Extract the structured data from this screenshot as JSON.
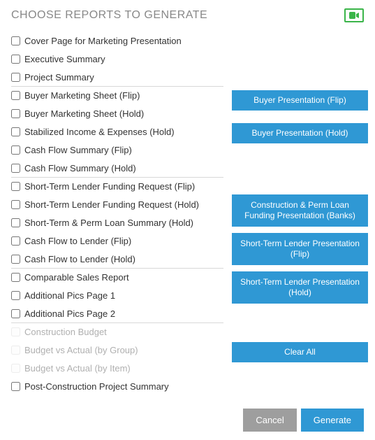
{
  "header": {
    "title": "CHOOSE REPORTS TO GENERATE"
  },
  "rows": [
    {
      "label": "Cover Page for Marketing Presentation",
      "enabled": true,
      "divider": false
    },
    {
      "label": "Executive Summary",
      "enabled": true,
      "divider": false
    },
    {
      "label": "Project Summary",
      "enabled": true,
      "divider": true
    },
    {
      "label": "Buyer Marketing Sheet (Flip)",
      "enabled": true,
      "divider": false
    },
    {
      "label": "Buyer Marketing Sheet (Hold)",
      "enabled": true,
      "divider": false
    },
    {
      "label": "Stabilized Income & Expenses (Hold)",
      "enabled": true,
      "divider": false
    },
    {
      "label": "Cash Flow Summary (Flip)",
      "enabled": true,
      "divider": false
    },
    {
      "label": "Cash Flow Summary (Hold)",
      "enabled": true,
      "divider": true
    },
    {
      "label": "Short-Term Lender Funding Request (Flip)",
      "enabled": true,
      "divider": false
    },
    {
      "label": "Short-Term Lender Funding Request (Hold)",
      "enabled": true,
      "divider": false
    },
    {
      "label": "Short-Term & Perm Loan Summary (Hold)",
      "enabled": true,
      "divider": false
    },
    {
      "label": "Cash Flow to Lender (Flip)",
      "enabled": true,
      "divider": false
    },
    {
      "label": "Cash Flow to Lender (Hold)",
      "enabled": true,
      "divider": true
    },
    {
      "label": "Comparable Sales Report",
      "enabled": true,
      "divider": false
    },
    {
      "label": "Additional Pics Page 1",
      "enabled": true,
      "divider": false
    },
    {
      "label": "Additional Pics Page 2",
      "enabled": true,
      "divider": true
    },
    {
      "label": "Construction Budget",
      "enabled": false,
      "divider": false
    },
    {
      "label": "Budget vs Actual (by Group)",
      "enabled": false,
      "divider": false
    },
    {
      "label": "Budget vs Actual (by Item)",
      "enabled": false,
      "divider": false
    },
    {
      "label": "Post-Construction Project Summary",
      "enabled": true,
      "divider": false
    }
  ],
  "actions": {
    "buyer_flip": "Buyer Presentation (Flip)",
    "buyer_hold": "Buyer Presentation (Hold)",
    "construction_perm": "Construction & Perm Loan Funding Presentation (Banks)",
    "lender_flip": "Short-Term Lender Presentation (Flip)",
    "lender_hold": "Short-Term Lender Presentation (Hold)",
    "clear_all": "Clear All"
  },
  "footer": {
    "cancel": "Cancel",
    "generate": "Generate"
  }
}
